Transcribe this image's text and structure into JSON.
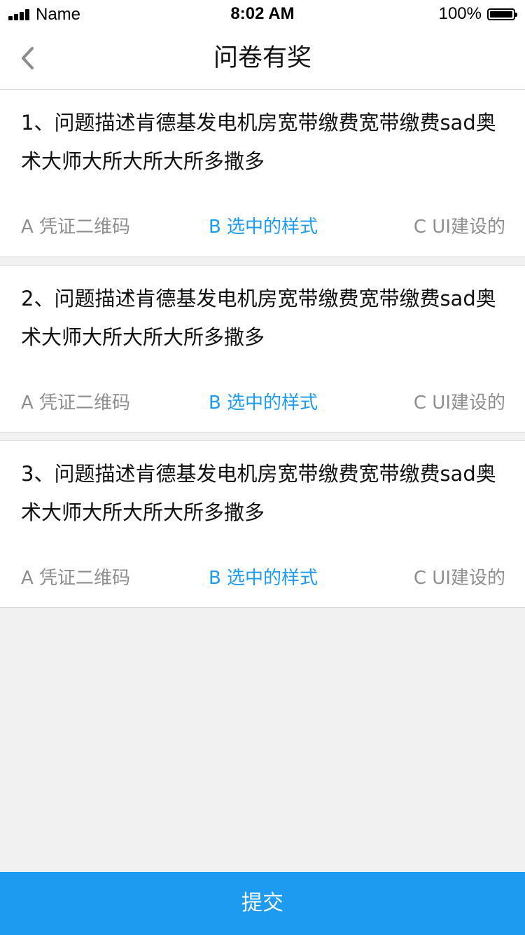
{
  "status_bar": {
    "carrier": "Name",
    "time": "8:02 AM",
    "battery_percent": "100%",
    "battery_level": 1.0
  },
  "nav": {
    "title": "问卷有奖",
    "back_icon": "chevron-left-icon"
  },
  "questions": [
    {
      "text": "1、问题描述肯德基发电机房宽带缴费宽带缴费sad奥术大师大所大所大所多撒多",
      "options": [
        {
          "label": "A 凭证二维码",
          "selected": false
        },
        {
          "label": "B 选中的样式",
          "selected": true
        },
        {
          "label": "C UI建设的",
          "selected": false
        }
      ]
    },
    {
      "text": "2、问题描述肯德基发电机房宽带缴费宽带缴费sad奥术大师大所大所大所多撒多",
      "options": [
        {
          "label": "A 凭证二维码",
          "selected": false
        },
        {
          "label": "B 选中的样式",
          "selected": true
        },
        {
          "label": "C UI建设的",
          "selected": false
        }
      ]
    },
    {
      "text": "3、问题描述肯德基发电机房宽带缴费宽带缴费sad奥术大师大所大所大所多撒多",
      "options": [
        {
          "label": "A 凭证二维码",
          "selected": false
        },
        {
          "label": "B 选中的样式",
          "selected": true
        },
        {
          "label": "C UI建设的",
          "selected": false
        }
      ]
    }
  ],
  "submit": {
    "label": "提交"
  },
  "colors": {
    "accent": "#1d9bf0",
    "option_text": "#8e8e8e",
    "background": "#f1f1f1"
  }
}
